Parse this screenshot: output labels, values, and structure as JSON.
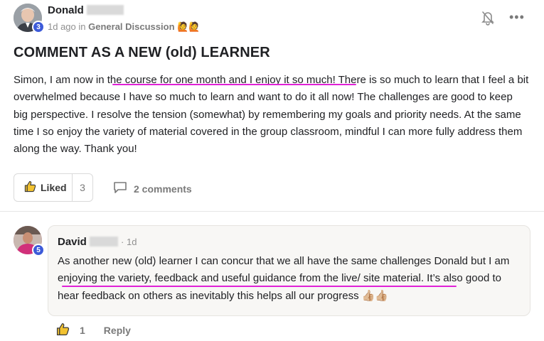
{
  "post": {
    "author_first": "Donald",
    "level": "3",
    "time_ago": "1d ago in",
    "category": "General Discussion",
    "category_emoji": "🙋🙋",
    "title": "COMMENT AS A NEW (old) LEARNER",
    "body_before": "Simon, I am now in t",
    "body_highlight": "he course for one month and I enjoy it so much!",
    "body_after": " There is so much to learn that I feel a bit overwhelmed because I have so much to learn and want to do it all now! The challenges are good to keep big perspective. I resolve the tension (somewhat) by remembering my goals and priority needs. At the same time I so enjoy the variety of material covered in the group classroom, mindful I can more fully address them along the way. Thank you!",
    "like_label": "Liked",
    "like_count": "3",
    "comments_label": "2 comments"
  },
  "reply": {
    "author_first": "David",
    "level": "5",
    "time": "· 1d",
    "body_before": "As another new (old) learner I can concur that we all have the same challenges Donald but I ",
    "body_highlight": "am enjoying the variety, feedback and useful guidance from the live/ site material",
    "body_after": ". It’s also good to hear feedback on others as inevitably this helps all our progress ",
    "thumbs_emoji": "👍🏼👍🏼",
    "like_count": "1",
    "reply_label": "Reply"
  },
  "colors": {
    "highlight_underline": "#e021d6",
    "level_badge": "#3d5bd9"
  },
  "icons": {
    "notification": "bell-off-icon",
    "more": "more-horizontal-icon",
    "like": "thumbs-up-icon",
    "comment": "comment-icon"
  }
}
